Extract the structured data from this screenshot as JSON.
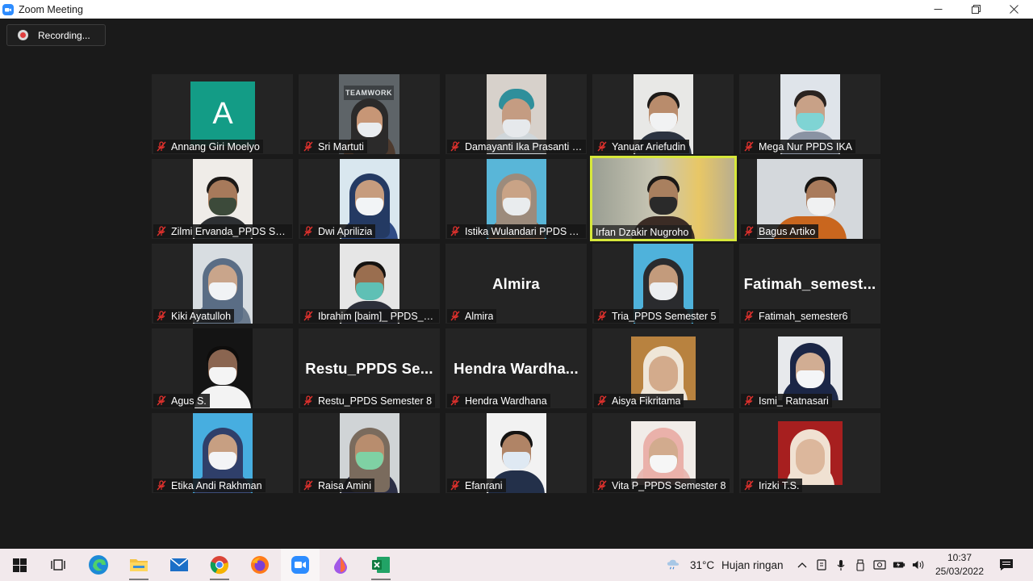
{
  "window": {
    "title": "Zoom Meeting"
  },
  "recording": {
    "label": "Recording..."
  },
  "participants": [
    {
      "name": "Annang Giri Moelyo",
      "avatar_letter": "A"
    },
    {
      "name": "Sri Martuti",
      "poster_text": "TEAMWORK"
    },
    {
      "name": "Damayanti Ika Prasanti P..."
    },
    {
      "name": "Yanuar Ariefudin"
    },
    {
      "name": "Mega Nur PPDS IKA"
    },
    {
      "name": "Zilmi Ervanda_PPDS Sem..."
    },
    {
      "name": "Dwi Aprilizia"
    },
    {
      "name": "Istika Wulandari PPDS An..."
    },
    {
      "name": "Irfan Dzakir Nugroho",
      "active_speaker": true
    },
    {
      "name": "Bagus Artiko"
    },
    {
      "name": "Kiki Ayatulloh"
    },
    {
      "name": "Ibrahim [baim]_ PPDS_Se..."
    },
    {
      "name": "Almira",
      "display_text": "Almira"
    },
    {
      "name": "Tria_PPDS Semester 5"
    },
    {
      "name": "Fatimah_semester6",
      "display_text": "Fatimah_semest..."
    },
    {
      "name": "Agus S."
    },
    {
      "name": "Restu_PPDS Semester 8",
      "display_text": "Restu_PPDS  Se..."
    },
    {
      "name": "Hendra Wardhana",
      "display_text": "Hendra  Wardha..."
    },
    {
      "name": "Aisya Fikritama"
    },
    {
      "name": "Ismi_ Ratnasari"
    },
    {
      "name": "Etika Andi Rakhman"
    },
    {
      "name": "Raisa Amini"
    },
    {
      "name": "Efanrani"
    },
    {
      "name": "Vita P_PPDS Semester 8"
    },
    {
      "name": "Irizki T.S."
    }
  ],
  "taskbar": {
    "apps": [
      "start",
      "task-view",
      "edge",
      "file-explorer",
      "mail",
      "chrome",
      "firefox",
      "zoom",
      "paint-3d",
      "excel"
    ],
    "weather": {
      "temperature": "31°C",
      "condition": "Hujan ringan"
    },
    "clock": {
      "time": "10:37",
      "date": "25/03/2022"
    }
  },
  "colors": {
    "active_speaker_border": "#d7e83a",
    "avatar_bg": "#139c86",
    "muted_mic": "#e0312d",
    "background": "#1a1a1a"
  }
}
